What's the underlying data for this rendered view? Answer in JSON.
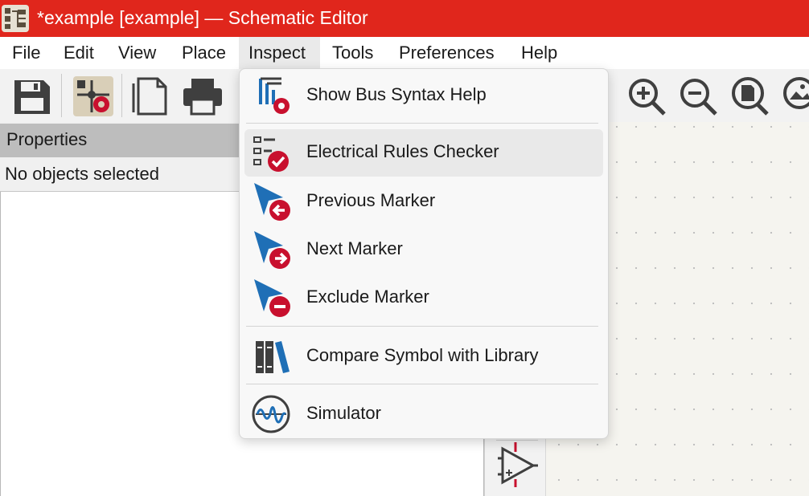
{
  "window": {
    "title": "*example [example] — Schematic Editor",
    "app_icon": "kicad-schematic-icon",
    "accent_color": "#e0261c"
  },
  "menubar": {
    "items": [
      "File",
      "Edit",
      "View",
      "Place",
      "Inspect",
      "Tools",
      "Preferences",
      "Help"
    ],
    "active": "Inspect"
  },
  "toolbar": {
    "icons": [
      "save-icon",
      "schematic-setup-icon",
      "page-settings-icon",
      "print-icon",
      "zoom-in-icon",
      "zoom-out-icon",
      "zoom-fit-icon",
      "image-icon"
    ]
  },
  "properties": {
    "header": "Properties",
    "status": "No objects selected"
  },
  "inspect_menu": {
    "items": [
      {
        "label": "Show Bus Syntax Help",
        "icon": "bus-syntax-help-icon"
      },
      {
        "label": "Electrical Rules Checker",
        "icon": "erc-icon",
        "highlighted": true
      },
      {
        "label": "Previous Marker",
        "icon": "previous-marker-icon"
      },
      {
        "label": "Next Marker",
        "icon": "next-marker-icon"
      },
      {
        "label": "Exclude Marker",
        "icon": "exclude-marker-icon"
      },
      {
        "label": "Compare Symbol with Library",
        "icon": "library-books-icon"
      },
      {
        "label": "Simulator",
        "icon": "simulator-icon"
      }
    ]
  },
  "vertical_toolbar": {
    "visible_icon": "opamp-symbol-icon"
  }
}
